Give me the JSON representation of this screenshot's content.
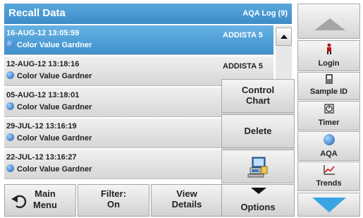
{
  "title": "Recall Data",
  "log_label": "AQA Log (9)",
  "rows": [
    {
      "datetime": "16-AUG-12  13:05:59",
      "param": "Color Value Gardner",
      "instrument": "ADDISTA 5"
    },
    {
      "datetime": "12-AUG-12  13:18:16",
      "param": "Color Value Gardner",
      "instrument": "ADDISTA 5"
    },
    {
      "datetime": "05-AUG-12  13:18:01",
      "param": "Color Value Gardner",
      "instrument": ""
    },
    {
      "datetime": "29-JUL-12  13:16:19",
      "param": "Color Value Gardner",
      "instrument": ""
    },
    {
      "datetime": "22-JUL-12  13:16:27",
      "param": "Color Value Gardner",
      "instrument": ""
    }
  ],
  "menu": {
    "control_chart_1": "Control",
    "control_chart_2": "Chart",
    "delete": "Delete"
  },
  "toolbar": {
    "main_menu_1": "Main",
    "main_menu_2": "Menu",
    "filter_1": "Filter:",
    "filter_2": "On",
    "view_details_1": "View",
    "view_details_2": "Details",
    "options": "Options"
  },
  "side": {
    "login": "Login",
    "sample_id": "Sample ID",
    "timer": "Timer",
    "aqa": "AQA",
    "trends": "Trends"
  },
  "colors": {
    "accent": "#3d8cc8",
    "selected_row": "#4a9ad5",
    "scroll_arrow": "#3aa5e3"
  }
}
